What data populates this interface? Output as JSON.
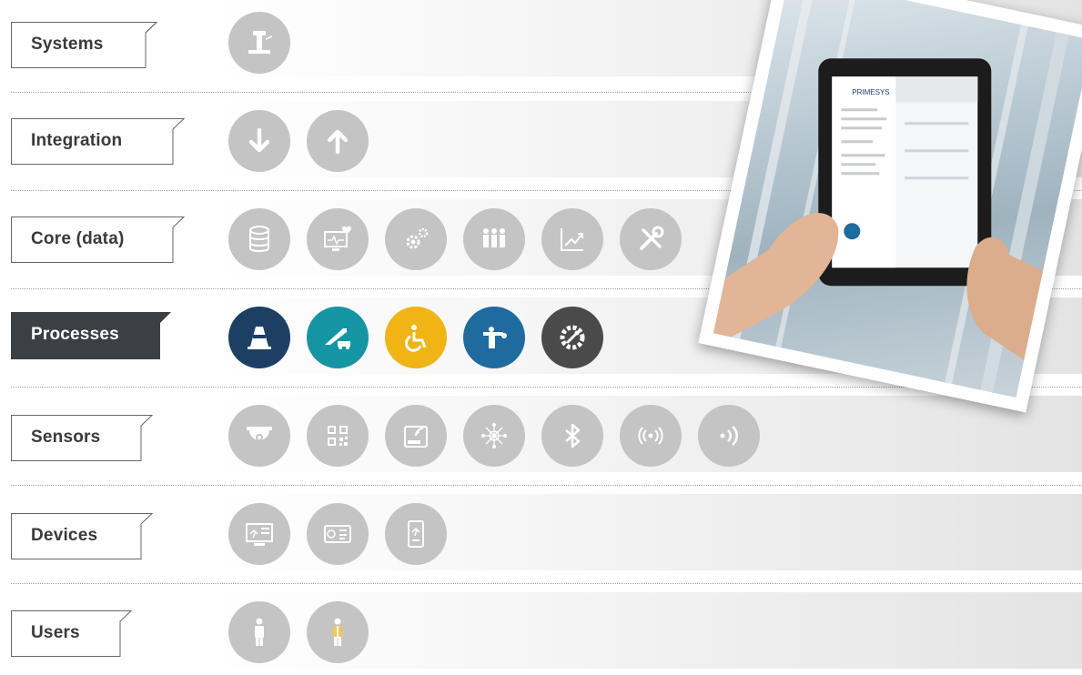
{
  "rows": [
    {
      "label": "Systems",
      "active": false,
      "icons": [
        "control-tower-icon"
      ]
    },
    {
      "label": "Integration",
      "active": false,
      "icons": [
        "arrow-down-icon",
        "arrow-up-icon"
      ]
    },
    {
      "label": "Core (data)",
      "active": false,
      "icons": [
        "database-icon",
        "monitor-heart-icon",
        "gears-icon",
        "people-group-icon",
        "trend-chart-icon",
        "tools-icon"
      ]
    },
    {
      "label": "Processes",
      "active": true,
      "icons": [
        "traffic-cone-icon",
        "stairs-truck-icon",
        "wheelchair-icon",
        "marshaller-icon",
        "wrench-gear-icon"
      ]
    },
    {
      "label": "Sensors",
      "active": false,
      "icons": [
        "dome-camera-icon",
        "qr-code-icon",
        "rfid-icon",
        "mesh-network-icon",
        "bluetooth-icon",
        "broadcast-icon",
        "signal-waves-icon"
      ]
    },
    {
      "label": "Devices",
      "active": false,
      "icons": [
        "display-screen-icon",
        "boarding-pass-icon",
        "smartphone-icon"
      ]
    },
    {
      "label": "Users",
      "active": false,
      "icons": [
        "person-icon",
        "worker-vest-icon"
      ]
    }
  ],
  "colors": {
    "inactive_icon": "#c4c4c4",
    "active_label_bg": "#3c3f44",
    "traffic-cone-icon": "#1d3f63",
    "stairs-truck-icon": "#1595a3",
    "wheelchair-icon": "#f0b414",
    "marshaller-icon": "#1f6a9e",
    "wrench-gear-icon": "#4a4a4a"
  },
  "photo": {
    "tablet_brand": "PRIMESYS"
  }
}
